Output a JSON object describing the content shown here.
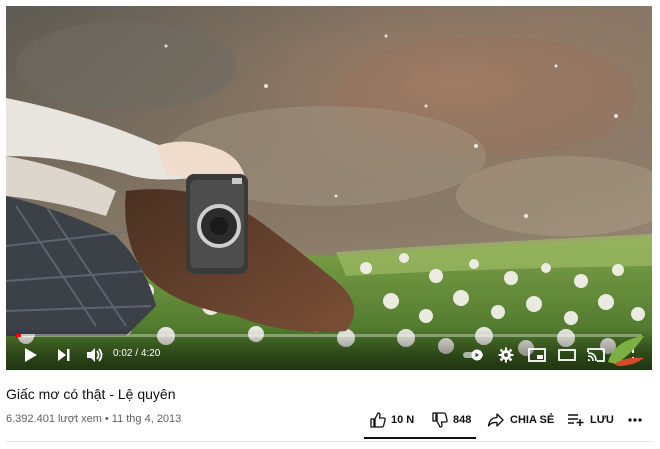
{
  "video": {
    "current_time": "0:02",
    "duration": "4:20",
    "time_separator": " / ",
    "progress_fraction": 0.008,
    "buffered_fraction": 0.03
  },
  "info": {
    "title": "Giấc mơ có thật - Lệ quyên",
    "views": "6.392.401 lượt xem",
    "separator": "•",
    "date": "11 thg 4, 2013"
  },
  "actions": {
    "like_count": "10 N",
    "dislike_count": "848",
    "share_label": "CHIA SẺ",
    "save_label": "LƯU"
  },
  "colors": {
    "progress": "#ff0000",
    "title_text": "#0f0f0f",
    "meta_text": "#606060"
  },
  "icons": {
    "play": "play-icon",
    "next": "next-icon",
    "volume": "volume-icon",
    "autoplay": "autoplay-toggle-icon",
    "settings": "gear-icon",
    "miniplayer": "miniplayer-icon",
    "theater": "theater-mode-icon",
    "cast": "cast-icon",
    "fullscreen": "fullscreen-icon",
    "like": "thumbs-up-icon",
    "dislike": "thumbs-down-icon",
    "share": "share-icon",
    "save": "save-playlist-icon",
    "more": "more-icon"
  }
}
